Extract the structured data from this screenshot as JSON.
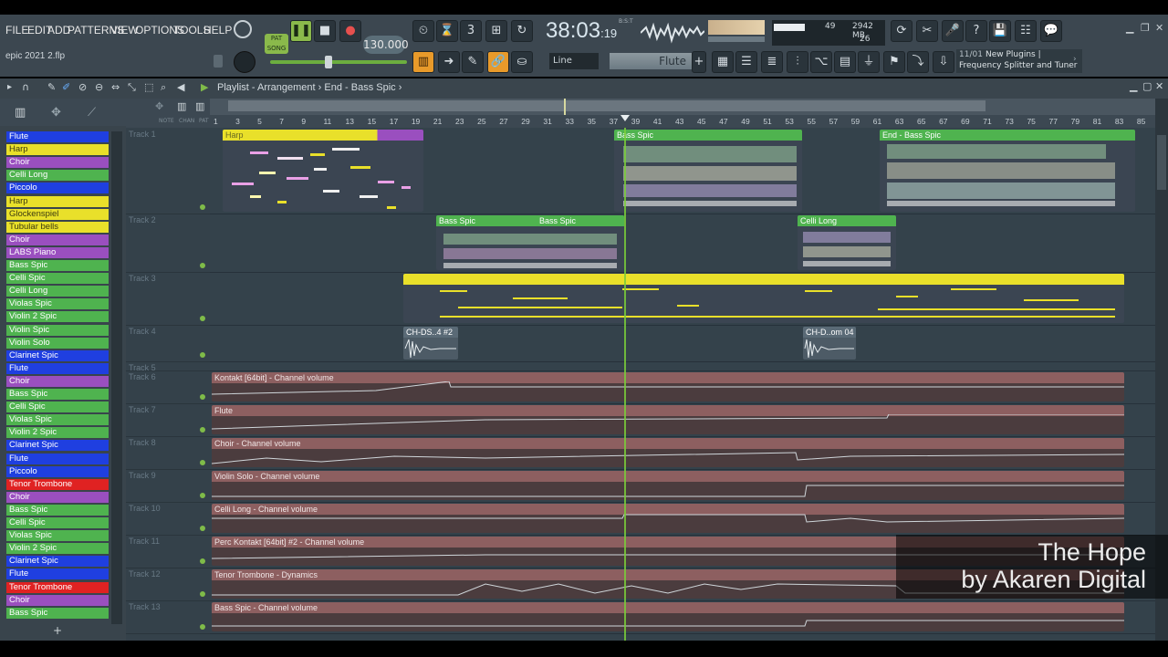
{
  "menu": [
    "FILE",
    "EDIT",
    "ADD",
    "PATTERNS",
    "VIEW",
    "OPTIONS",
    "TOOLS",
    "HELP"
  ],
  "file_name": "epic 2021 2.flp",
  "transport": {
    "mode_top": "PAT",
    "mode_bottom": "SONG",
    "tempo": "130.000",
    "time_main": "38:03",
    "time_sub": "19",
    "time_unit": "B:S:T"
  },
  "cpu": {
    "mem": "2942 MB",
    "val1": "49",
    "val2": "26"
  },
  "snap": "Line",
  "channel_selector": "Flute",
  "news": {
    "date": "11/01",
    "line1": "New Plugins |",
    "line2": "Frequency Splitter and Tuner"
  },
  "playlist": {
    "title": "Playlist - Arrangement",
    "pattern": "End - Bass Spic"
  },
  "colors": {
    "blue": "#1f3fe0",
    "yellow": "#e9e02a",
    "purple": "#9a4fbf",
    "green": "#4fb34f",
    "red": "#e02222",
    "audio": "#5a6a76",
    "auto": "#8d5f60"
  },
  "channels": [
    {
      "name": "Flute",
      "color": "blue"
    },
    {
      "name": "Harp",
      "color": "yellow"
    },
    {
      "name": "Choir",
      "color": "purple"
    },
    {
      "name": "Celli Long",
      "color": "green"
    },
    {
      "name": "Piccolo",
      "color": "blue"
    },
    {
      "name": "Harp",
      "color": "yellow"
    },
    {
      "name": "Glockenspiel",
      "color": "yellow"
    },
    {
      "name": "Tubular bells",
      "color": "yellow"
    },
    {
      "name": "Choir",
      "color": "purple"
    },
    {
      "name": "LABS Piano",
      "color": "purple"
    },
    {
      "name": "Bass Spic",
      "color": "green"
    },
    {
      "name": "Celli Spic",
      "color": "green"
    },
    {
      "name": "Celli Long",
      "color": "green"
    },
    {
      "name": "Violas Spic",
      "color": "green"
    },
    {
      "name": "Violin 2 Spic",
      "color": "green"
    },
    {
      "name": "Violin Spic",
      "color": "green"
    },
    {
      "name": "Violin Solo",
      "color": "green"
    },
    {
      "name": "Clarinet Spic",
      "color": "blue"
    },
    {
      "name": "Flute",
      "color": "blue"
    },
    {
      "name": "Choir",
      "color": "purple"
    },
    {
      "name": "Bass Spic",
      "color": "green"
    },
    {
      "name": "Celli Spic",
      "color": "green"
    },
    {
      "name": "Violas Spic",
      "color": "green"
    },
    {
      "name": "Violin 2 Spic",
      "color": "green"
    },
    {
      "name": "Clarinet Spic",
      "color": "blue"
    },
    {
      "name": "Flute",
      "color": "blue"
    },
    {
      "name": "Piccolo",
      "color": "blue"
    },
    {
      "name": "Tenor Trombone",
      "color": "red"
    },
    {
      "name": "Choir",
      "color": "purple"
    },
    {
      "name": "Bass Spic",
      "color": "green"
    },
    {
      "name": "Celli Spic",
      "color": "green"
    },
    {
      "name": "Violas Spic",
      "color": "green"
    },
    {
      "name": "Violin 2 Spic",
      "color": "green"
    },
    {
      "name": "Clarinet Spic",
      "color": "blue"
    },
    {
      "name": "Flute",
      "color": "blue"
    },
    {
      "name": "Tenor Trombone",
      "color": "red"
    },
    {
      "name": "Choir",
      "color": "purple"
    },
    {
      "name": "Bass Spic",
      "color": "green"
    }
  ],
  "tracks": [
    "Track 1",
    "Track 2",
    "Track 3",
    "Track 4",
    "Track 5",
    "Track 6",
    "Track 7",
    "Track 8",
    "Track 9",
    "Track 10",
    "Track 11",
    "Track 12",
    "Track 13"
  ],
  "ruler": [
    "1",
    "3",
    "5",
    "7",
    "9",
    "11",
    "13",
    "15",
    "17",
    "19",
    "21",
    "23",
    "25",
    "27",
    "29",
    "31",
    "33",
    "35",
    "37",
    "39",
    "41",
    "43",
    "45",
    "47",
    "49",
    "51",
    "53",
    "55",
    "57",
    "59",
    "61",
    "63",
    "65",
    "67",
    "69",
    "71",
    "73",
    "75",
    "77",
    "79",
    "81",
    "83",
    "85"
  ],
  "clips": {
    "harp": "Harp",
    "bass1": "Bass Spic",
    "end": "End - Bass Spic",
    "bass2": "Bass Spic",
    "bass3": "Bass Spic",
    "celli": "Celli Long",
    "audio1": "CH-DS..4 #2",
    "audio2": "CH-D..om 04"
  },
  "automation": [
    "Kontakt [64bit] - Channel volume",
    "Flute",
    "Choir - Channel volume",
    "Violin Solo - Channel volume",
    "Celli Long - Channel volume",
    "Perc Kontakt [64bit] #2 - Channel volume",
    "Tenor Trombone - Dynamics",
    "Bass Spic - Channel volume"
  ],
  "caption": {
    "line1": "The Hope",
    "line2": "by Akaren Digital"
  }
}
